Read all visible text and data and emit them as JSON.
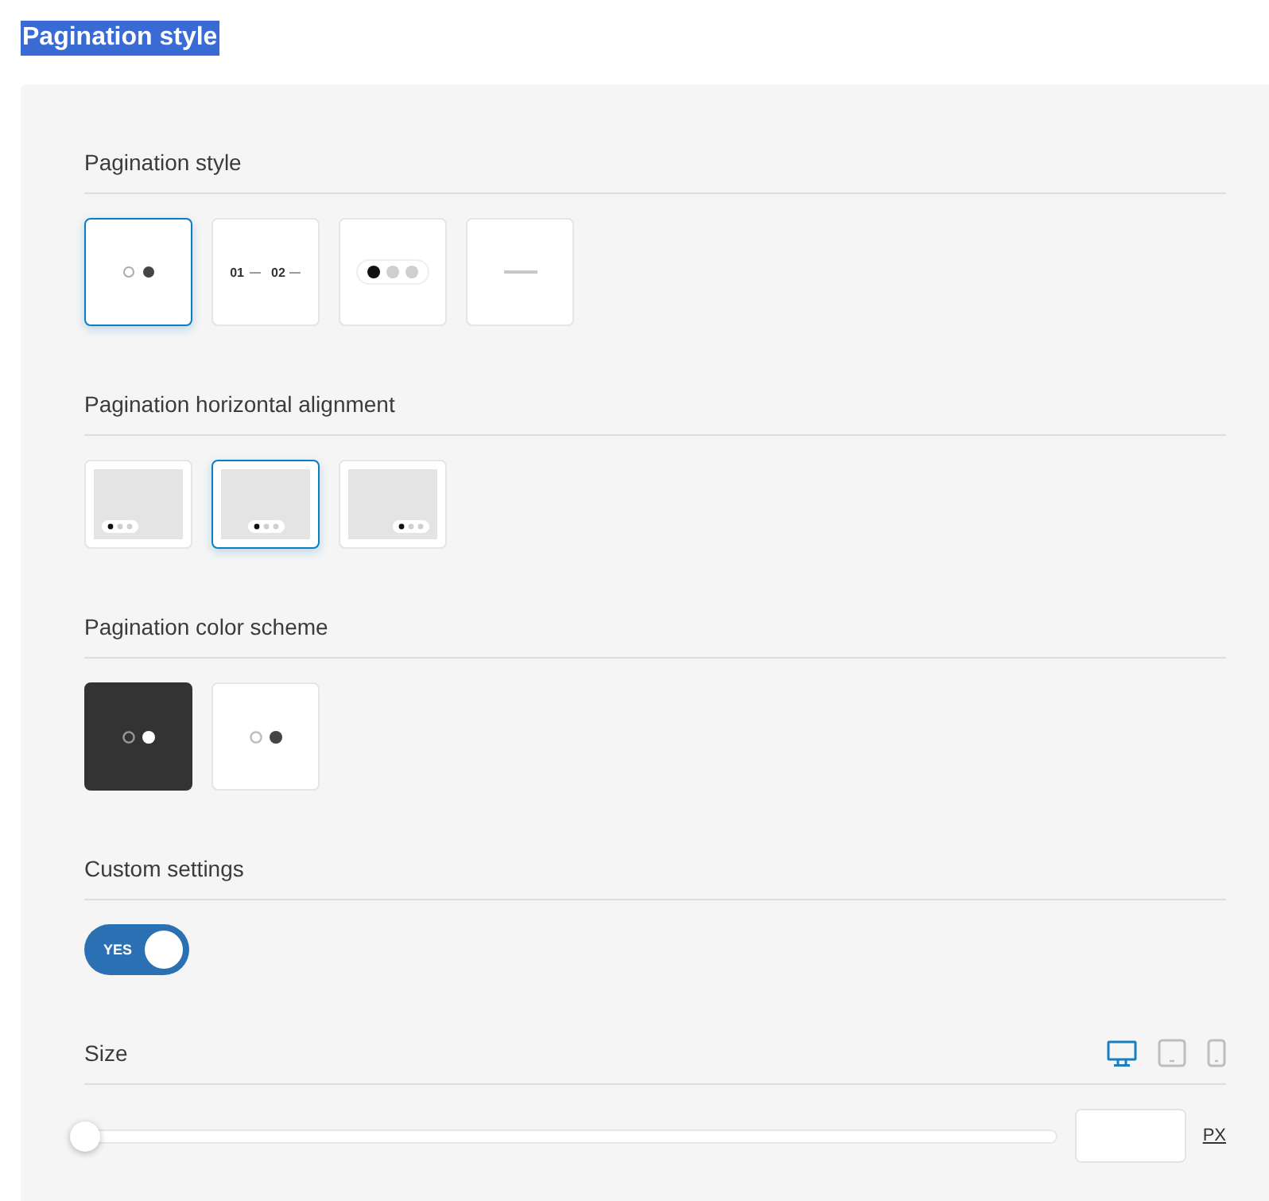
{
  "page_title": {
    "text": "Pagination style",
    "highlighted": true
  },
  "pagination_style": {
    "heading": "Pagination style",
    "options": [
      {
        "kind": "dots",
        "selected": true
      },
      {
        "kind": "numbers",
        "labels": [
          "01",
          "02"
        ],
        "selected": false
      },
      {
        "kind": "pill",
        "selected": false
      },
      {
        "kind": "line",
        "selected": false
      }
    ]
  },
  "horizontal_alignment": {
    "heading": "Pagination horizontal alignment",
    "options": [
      {
        "kind": "left",
        "selected": false
      },
      {
        "kind": "center",
        "selected": true
      },
      {
        "kind": "right",
        "selected": false
      }
    ]
  },
  "color_scheme": {
    "heading": "Pagination color scheme",
    "options": [
      {
        "kind": "dark",
        "selected": false
      },
      {
        "kind": "light",
        "selected": false
      }
    ]
  },
  "custom_settings": {
    "heading": "Custom settings",
    "toggle": {
      "label": "YES",
      "on": true
    }
  },
  "size": {
    "heading": "Size",
    "devices": [
      {
        "kind": "desktop",
        "selected": true
      },
      {
        "kind": "tablet",
        "selected": false
      },
      {
        "kind": "mobile",
        "selected": false
      }
    ],
    "slider": {
      "level": 0
    },
    "unit": "PX"
  }
}
